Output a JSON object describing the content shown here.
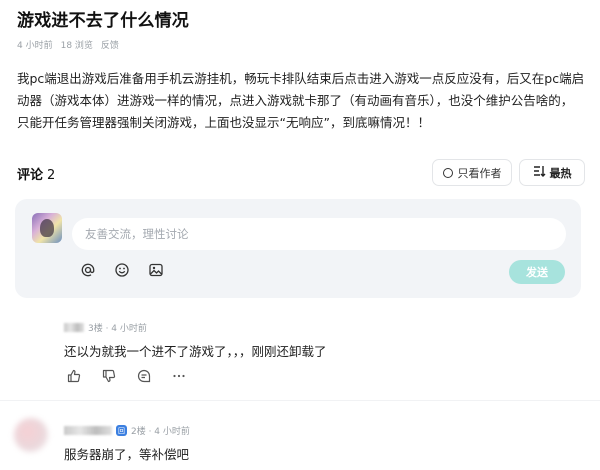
{
  "post": {
    "title": "游戏进不去了什么情况",
    "time": "4 小时前",
    "views": "18 浏览",
    "report": "反馈",
    "body": "我pc端退出游戏后准备用手机云游挂机，畅玩卡排队结束后点击进入游戏一点反应没有，后又在pc端启动器（游戏本体）进游戏一样的情况，点进入游戏就卡那了（有动画有音乐），也没个维护公告啥的，只能开任务管理器强制关闭游戏，上面也没显示“无响应”，到底嘛情况！！"
  },
  "comments_section": {
    "label": "评论",
    "count": "2",
    "filter_author": "只看作者",
    "sort_hot": "最热"
  },
  "reply_box": {
    "placeholder": "友善交流，理性讨论",
    "send_label": "发送",
    "tools": [
      "at-icon",
      "emoji-icon",
      "image-icon"
    ]
  },
  "comments": [
    {
      "floor_time": "3楼 · 4 小时前",
      "text": "还以为就我一个进不了游戏了，，，刚刚还卸载了",
      "actions": [
        "thumbs-up-icon",
        "thumbs-down-icon",
        "reply-icon",
        "more-icon"
      ]
    },
    {
      "floor_time": "2楼 · 4 小时前",
      "badge": "回",
      "text": "服务器崩了，等补偿吧"
    }
  ],
  "colors": {
    "accent": "#a7e3dd",
    "reply_bg": "#f2f4f7",
    "muted": "#9aa0a6",
    "badge": "#3b7fe0"
  }
}
